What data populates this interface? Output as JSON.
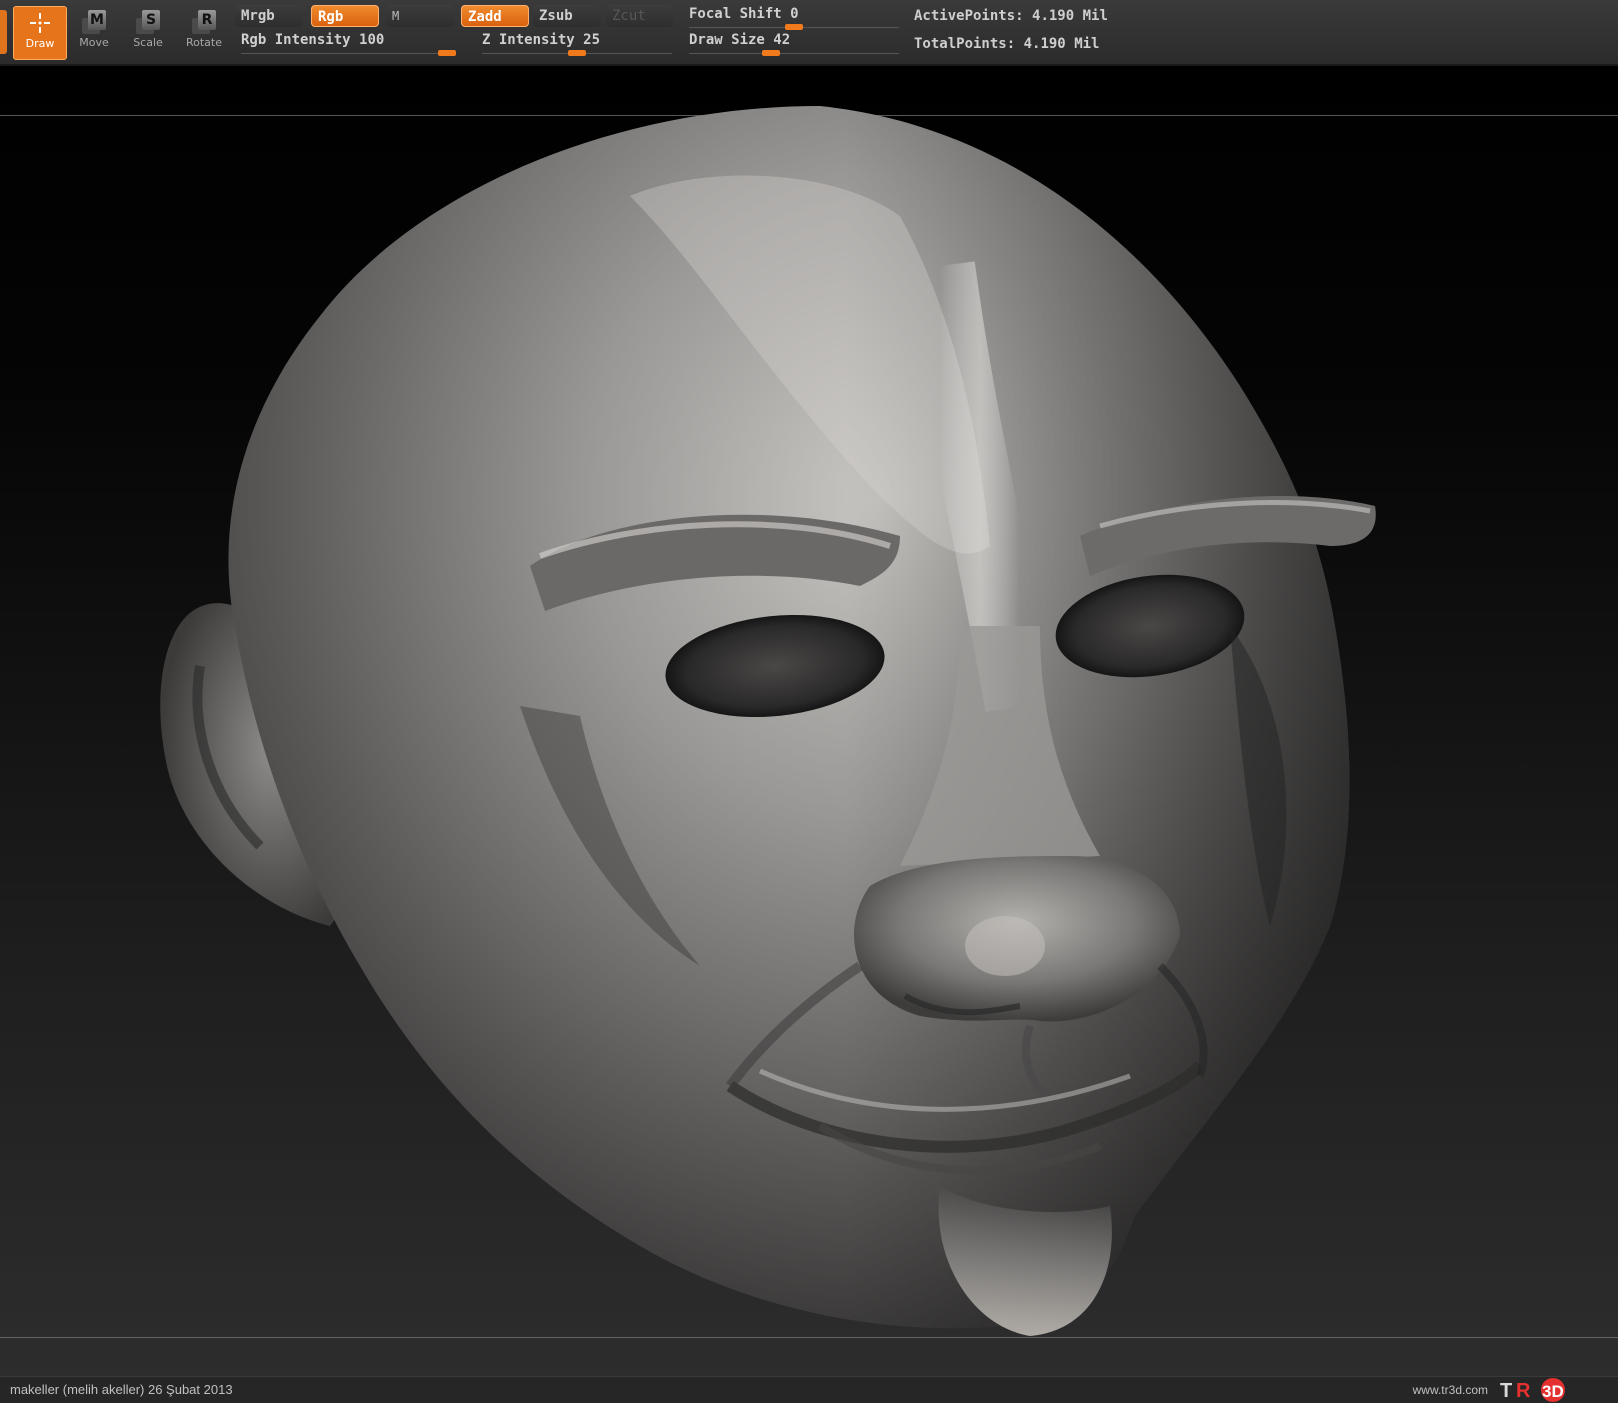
{
  "toolbar": {
    "tools": [
      {
        "label": "Draw",
        "letter": "",
        "active": true
      },
      {
        "label": "Move",
        "letter": "M",
        "active": false
      },
      {
        "label": "Scale",
        "letter": "S",
        "active": false
      },
      {
        "label": "Rotate",
        "letter": "R",
        "active": false
      }
    ],
    "modes": {
      "mrgb": "Mrgb",
      "rgb": "Rgb",
      "m": "M",
      "zadd": "Zadd",
      "zsub": "Zsub",
      "zcut": "Zcut"
    },
    "rgb_intensity": {
      "label": "Rgb Intensity",
      "value": 100
    },
    "z_intensity": {
      "label": "Z Intensity",
      "value": 25
    },
    "focal_shift": {
      "label": "Focal Shift",
      "value": 0
    },
    "draw_size": {
      "label": "Draw Size",
      "value": 42
    },
    "active_points": {
      "label": "ActivePoints:",
      "value": "4.190",
      "unit": "Mil"
    },
    "total_points": {
      "label": "TotalPoints:",
      "value": "4.190",
      "unit": "Mil"
    }
  },
  "slider_levels": {
    "rgb_intensity": 1.0,
    "z_intensity": 0.5,
    "focal_shift": 0.5,
    "draw_size": 0.38
  },
  "statusbar": {
    "credit": "makeller (melih akeller)  26 Şubat 2013",
    "site": "www.tr3d.com",
    "logo_text": "TR3D"
  },
  "colors": {
    "accent": "#e6741b",
    "toolbar_bg": "#2f2f2f",
    "model": "#8e8e8e"
  }
}
